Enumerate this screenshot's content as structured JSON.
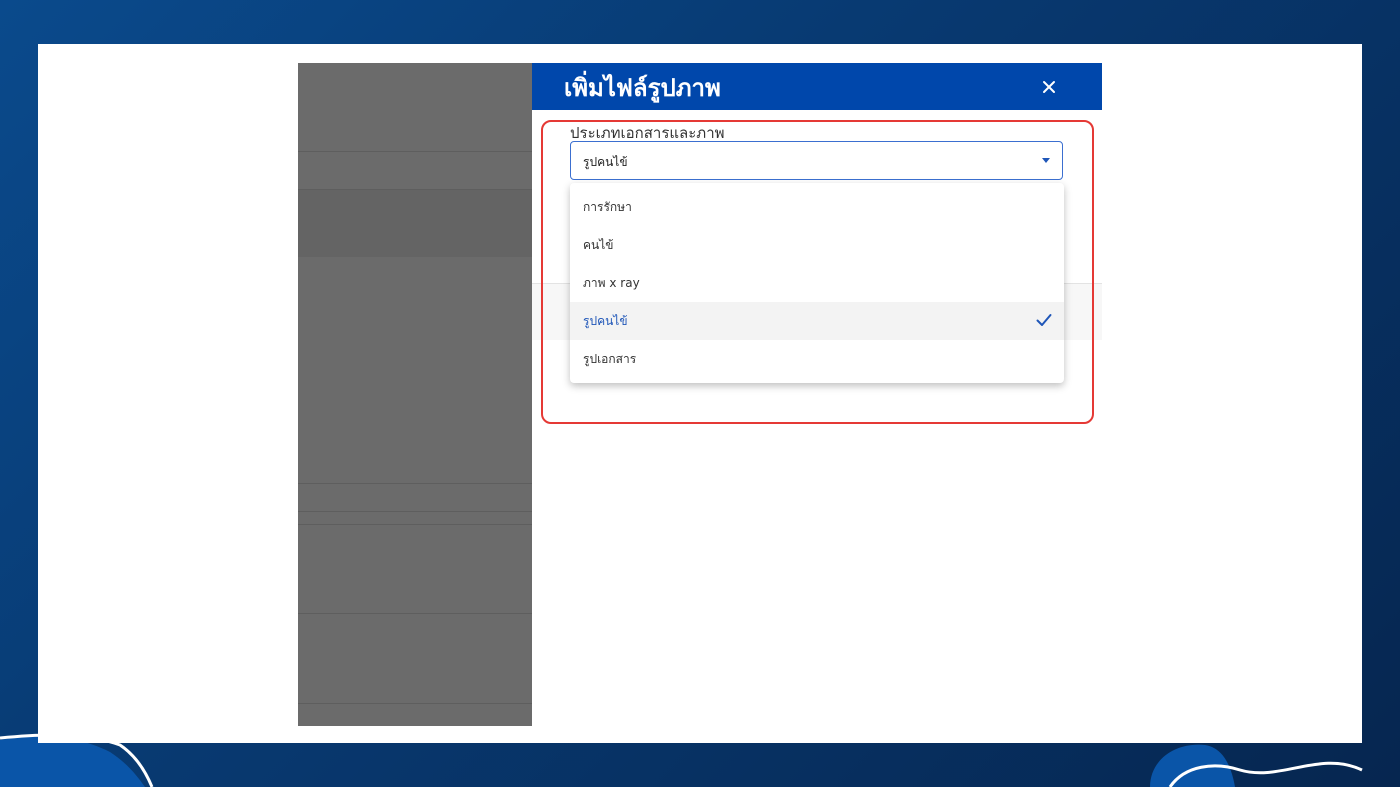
{
  "dialog": {
    "title": "เพิ่มไฟล์รูปภาพ",
    "close_icon": "close-icon"
  },
  "field": {
    "label": "ประเภทเอกสารและภาพ",
    "selected_value": "รูปคนไข้",
    "caret_icon": "caret-down-icon"
  },
  "options": [
    {
      "label": "การรักษา",
      "selected": false
    },
    {
      "label": "คนไข้",
      "selected": false
    },
    {
      "label": "ภาพ x ray",
      "selected": false
    },
    {
      "label": "รูปคนไข้",
      "selected": true
    },
    {
      "label": "รูปเอกสาร",
      "selected": false
    }
  ],
  "colors": {
    "header_bg": "#0047ab",
    "accent": "#1f56b8",
    "highlight_border": "#e53935",
    "background": "#083a72"
  }
}
